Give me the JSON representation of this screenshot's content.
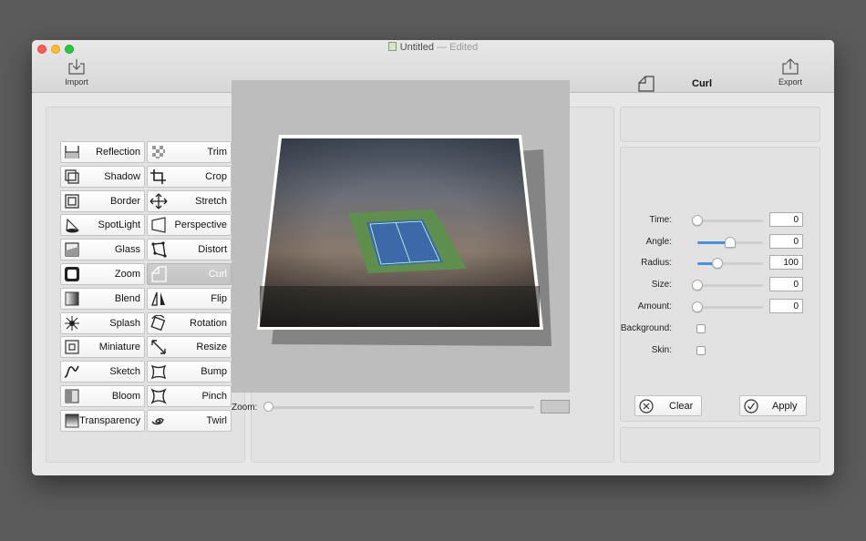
{
  "window": {
    "title": "Untitled",
    "edited": "— Edited"
  },
  "toolbar": {
    "import_label": "Import",
    "export_label": "Export"
  },
  "effects_left": [
    {
      "label": "Reflection",
      "icon": "reflection-icon"
    },
    {
      "label": "Shadow",
      "icon": "shadow-icon"
    },
    {
      "label": "Border",
      "icon": "border-icon"
    },
    {
      "label": "SpotLight",
      "icon": "spotlight-icon"
    },
    {
      "label": "Glass",
      "icon": "glass-icon"
    },
    {
      "label": "Zoom",
      "icon": "zoom-icon"
    },
    {
      "label": "Blend",
      "icon": "blend-icon"
    },
    {
      "label": "Splash",
      "icon": "splash-icon"
    },
    {
      "label": "Miniature",
      "icon": "miniature-icon"
    },
    {
      "label": "Sketch",
      "icon": "sketch-icon"
    },
    {
      "label": "Bloom",
      "icon": "bloom-icon"
    },
    {
      "label": "Transparency",
      "icon": "transparency-icon"
    }
  ],
  "effects_right": [
    {
      "label": "Trim",
      "icon": "trim-icon"
    },
    {
      "label": "Crop",
      "icon": "crop-icon"
    },
    {
      "label": "Stretch",
      "icon": "stretch-icon"
    },
    {
      "label": "Perspective",
      "icon": "perspective-icon"
    },
    {
      "label": "Distort",
      "icon": "distort-icon"
    },
    {
      "label": "Curl",
      "icon": "curl-icon"
    },
    {
      "label": "Flip",
      "icon": "flip-icon"
    },
    {
      "label": "Rotation",
      "icon": "rotation-icon"
    },
    {
      "label": "Resize",
      "icon": "resize-icon"
    },
    {
      "label": "Bump",
      "icon": "bump-icon"
    },
    {
      "label": "Pinch",
      "icon": "pinch-icon"
    },
    {
      "label": "Twirl",
      "icon": "twirl-icon"
    }
  ],
  "selected_effect": "Curl",
  "preview": {
    "zoom_label": "Zoom:",
    "zoom_level": 0
  },
  "inspector": {
    "title": "Curl",
    "params": [
      {
        "label": "Time:",
        "value": "0",
        "level": 0
      },
      {
        "label": "Angle:",
        "value": "0",
        "level": 0.5
      },
      {
        "label": "Radius:",
        "value": "100",
        "level": 0.3
      },
      {
        "label": "Size:",
        "value": "0",
        "level": 0
      },
      {
        "label": "Amount:",
        "value": "0",
        "level": 0
      }
    ],
    "checks": [
      {
        "label": "Background:",
        "checked": false
      },
      {
        "label": "Skin:",
        "checked": false
      }
    ]
  },
  "actions": {
    "clear_label": "Clear",
    "apply_label": "Apply"
  },
  "colors": {
    "accent": "#4a90e2",
    "window_bg": "#e7e7e7",
    "desktop": "#5b5b5b"
  }
}
